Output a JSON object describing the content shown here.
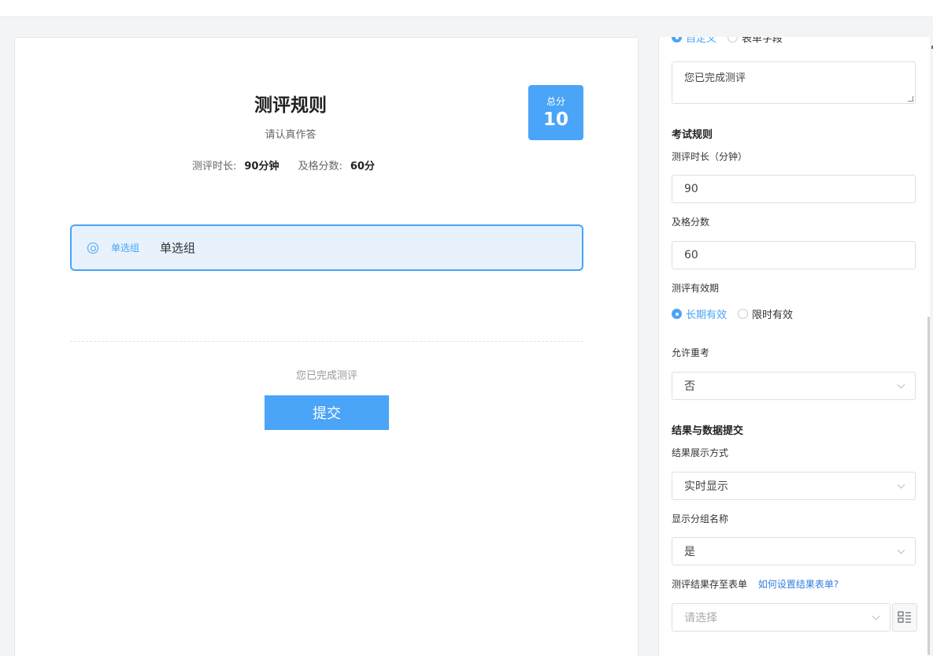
{
  "preview": {
    "title": "测评规则",
    "subtitle": "请认真作答",
    "duration_label": "测评时长:",
    "duration_value": "90分钟",
    "pass_label": "及格分数:",
    "pass_value": "60分",
    "score_label": "总分",
    "score_value": "10",
    "group_tag": "单选组",
    "group_name": "单选组",
    "done_text": "您已完成测评",
    "submit_label": "提交"
  },
  "panel": {
    "top_radio_1": "自定义",
    "top_radio_2": "表单字段",
    "completion_text": "您已完成测评",
    "exam_rules_title": "考试规则",
    "duration_label": "测评时长（分钟）",
    "duration_value": "90",
    "pass_label": "及格分数",
    "pass_value": "60",
    "validity_label": "测评有效期",
    "validity_options": [
      "长期有效",
      "限时有效"
    ],
    "retake_label": "允许重考",
    "retake_value": "否",
    "results_title": "结果与数据提交",
    "display_mode_label": "结果展示方式",
    "display_mode_value": "实时显示",
    "show_group_label": "显示分组名称",
    "show_group_value": "是",
    "save_form_label": "测评结果存至表单",
    "save_form_link": "如何设置结果表单?",
    "save_form_placeholder": "请选择"
  },
  "colors": {
    "accent": "#4aa4f8",
    "link": "#2f7fe0"
  },
  "icons": [
    "target-icon",
    "chevron-down-icon",
    "form-list-icon"
  ]
}
